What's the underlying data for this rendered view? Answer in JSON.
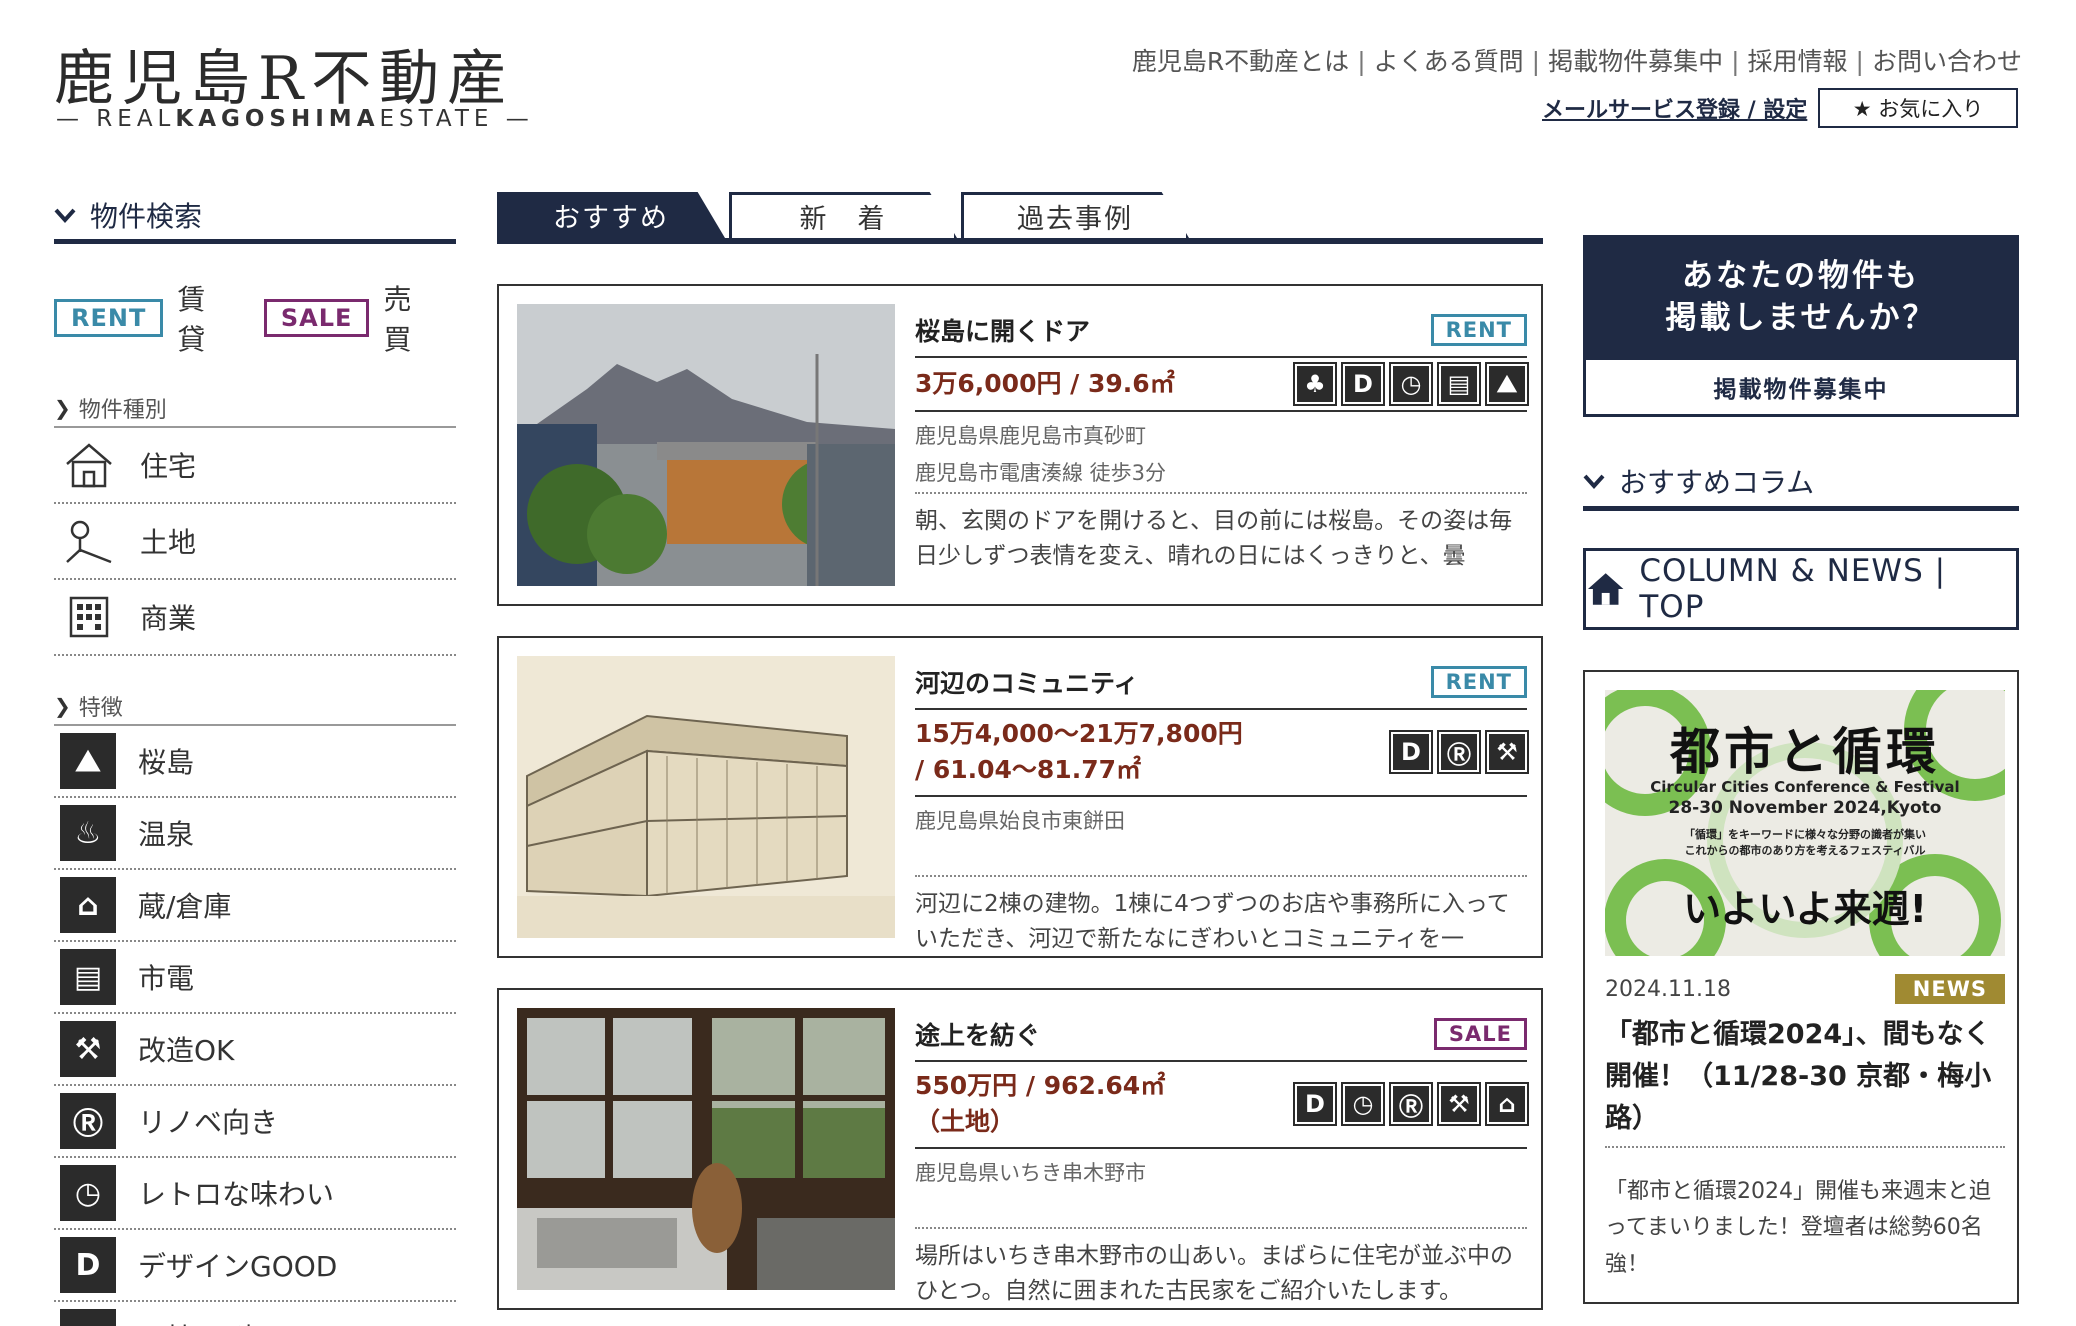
{
  "header": {
    "logo_title": "鹿児島R不動産",
    "logo_sub_pre": "— REAL",
    "logo_sub_bold": "KAGOSHIMA",
    "logo_sub_post": "ESTATE —",
    "nav": [
      "鹿児島R不動産とは",
      "よくある質問",
      "掲載物件募集中",
      "採用情報",
      "お問い合わせ"
    ],
    "mail_link": "メールサービス登録 / 設定",
    "favorites": "★ お気に入り"
  },
  "sidebar": {
    "search_title": "物件検索",
    "rent_tag": "RENT",
    "rent_label": "賃貸",
    "sale_tag": "SALE",
    "sale_label": "売買",
    "type_head": "物件種別",
    "types": [
      {
        "label": "住宅",
        "icon": "house-icon"
      },
      {
        "label": "土地",
        "icon": "land-icon"
      },
      {
        "label": "商業",
        "icon": "building-icon"
      }
    ],
    "feature_head": "特徴",
    "features": [
      {
        "label": "桜島",
        "icon": "sakurajima-icon",
        "glyph": "⛰"
      },
      {
        "label": "温泉",
        "icon": "onsen-icon",
        "glyph": "♨"
      },
      {
        "label": "蔵/倉庫",
        "icon": "storehouse-icon",
        "glyph": "⌂"
      },
      {
        "label": "市電",
        "icon": "tram-icon",
        "glyph": "▤"
      },
      {
        "label": "改造OK",
        "icon": "drill-icon",
        "glyph": "⚒"
      },
      {
        "label": "リノベ向き",
        "icon": "renovation-icon",
        "glyph": "Ⓡ"
      },
      {
        "label": "レトロな味わい",
        "icon": "retro-icon",
        "glyph": "◷"
      },
      {
        "label": "デザインGOOD",
        "icon": "design-icon",
        "glyph": "D"
      },
      {
        "label": "一棟/戸建",
        "icon": "whole-building-icon",
        "glyph": "⌂"
      }
    ]
  },
  "tabs": [
    "おすすめ",
    "新　着",
    "過去事例"
  ],
  "cards": [
    {
      "title": "桜島に開くドア",
      "tag": "RENT",
      "price": "3万6,000円 / 39.6㎡",
      "addr1": "鹿児島県鹿児島市真砂町",
      "addr2": "鹿児島市電唐湊線 徒歩3分",
      "desc": "朝、玄関のドアを開けると、目の前には桜島。その姿は毎日少しずつ表情を変え、晴れの日にはくっきりと、曇",
      "icons": [
        "forest-icon",
        "design-icon",
        "retro-icon",
        "tram-icon",
        "sakurajima-icon"
      ],
      "glyphs": [
        "♣",
        "D",
        "◷",
        "▤",
        "⛰"
      ]
    },
    {
      "title": "河辺のコミュニティ",
      "tag": "RENT",
      "price": "15万4,000〜21万7,800円 / 61.04〜81.77㎡",
      "addr1": "鹿児島県始良市東餅田",
      "addr2": "",
      "desc": "河辺に2棟の建物。1棟に4つずつのお店や事務所に入っていただき、河辺で新たなにぎわいとコミュニティを一",
      "icons": [
        "design-icon",
        "renovation-icon",
        "drill-icon"
      ],
      "glyphs": [
        "D",
        "Ⓡ",
        "⚒"
      ]
    },
    {
      "title": "途上を紡ぐ",
      "tag": "SALE",
      "price": "550万円 / 962.64㎡（土地）",
      "addr1": "鹿児島県いちき串木野市",
      "addr2": "",
      "desc": "場所はいちき串木野市の山あい。まばらに住宅が並ぶ中のひとつ。自然に囲まれた古民家をご紹介いたします。",
      "icons": [
        "design-icon",
        "retro-icon",
        "renovation-icon",
        "drill-icon",
        "whole-building-icon"
      ],
      "glyphs": [
        "D",
        "◷",
        "Ⓡ",
        "⚒",
        "⌂"
      ]
    }
  ],
  "promo": {
    "line1": "あなたの物件も",
    "line2": "掲載しませんか？",
    "button": "掲載物件募集中"
  },
  "column": {
    "head": "おすすめコラム",
    "button": "COLUMN & NEWS | TOP"
  },
  "news": {
    "img_title": "都市と循環",
    "img_sub1": "Circular Cities Conference & Festival",
    "img_sub2": "28-30 November 2024,Kyoto",
    "img_sub3": "「循環」をキーワードに様々な分野の識者が集い",
    "img_sub4": "これからの都市のあり方を考えるフェスティバル",
    "img_big": "いよいよ来週!",
    "date": "2024.11.18",
    "badge": "NEWS",
    "title": "「都市と循環2024」、間もなく開催！（11/28-30 京都・梅小路）",
    "desc": "「都市と循環2024」開催も来週末と迫ってまいりました！登壇者は総勢60名強！"
  }
}
